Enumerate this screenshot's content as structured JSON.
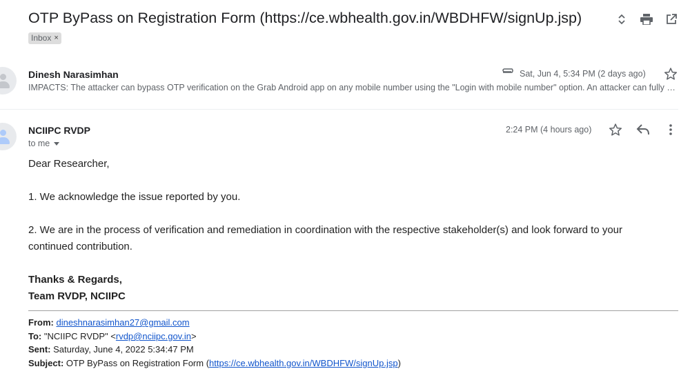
{
  "thread": {
    "subject": "OTP ByPass on Registration Form (https://ce.wbhealth.gov.in/WBDHFW/signUp.jsp)",
    "label": "Inbox",
    "label_remove": "×"
  },
  "icons": {
    "expand": "unfold-icon",
    "print": "print-icon",
    "popout": "open-in-new-icon",
    "star": "star-icon",
    "reply": "reply-icon",
    "more": "more-vert-icon",
    "attachment": "paperclip-icon"
  },
  "message1": {
    "sender": "Dinesh Narasimhan",
    "date": "Sat, Jun 4, 5:34 PM (2 days ago)",
    "snippet": "IMPACTS: The attacker can bypass OTP verification on the Grab Android app on any mobile number using the \"Login with mobile number\" option. An attacker can fully take over..."
  },
  "message2": {
    "sender": "NCIIPC RVDP",
    "to": "to me",
    "date": "2:24 PM (4 hours ago)",
    "greeting": "Dear Researcher,",
    "line1": "1. We acknowledge the issue reported by you.",
    "line2a": "2. We are in the process of verification and remediation in coordination with the respective stakeholder(s) and look forward to your",
    "line2b": "continued contribution.",
    "signoff1": "Thanks & Regards,",
    "signoff2": "Team RVDP, NCIIPC"
  },
  "quoted": {
    "from_label": "From:",
    "from_value": "dineshnarasimhan27@gmail.com",
    "to_label": "To:",
    "to_name": "\"NCIIPC RVDP\" <",
    "to_email": "rvdp@nciipc.gov.in",
    "to_close": ">",
    "sent_label": "Sent:",
    "sent_value": "Saturday, June 4, 2022 5:34:47 PM",
    "subject_label": "Subject:",
    "subject_prefix": "OTP ByPass on Registration Form (",
    "subject_link": "https://ce.wbhealth.gov.in/WBDHFW/signUp.jsp",
    "subject_suffix": ")"
  },
  "colors": {
    "link": "#1155cc",
    "muted": "#5f6368",
    "chip_bg": "#dddddd"
  }
}
